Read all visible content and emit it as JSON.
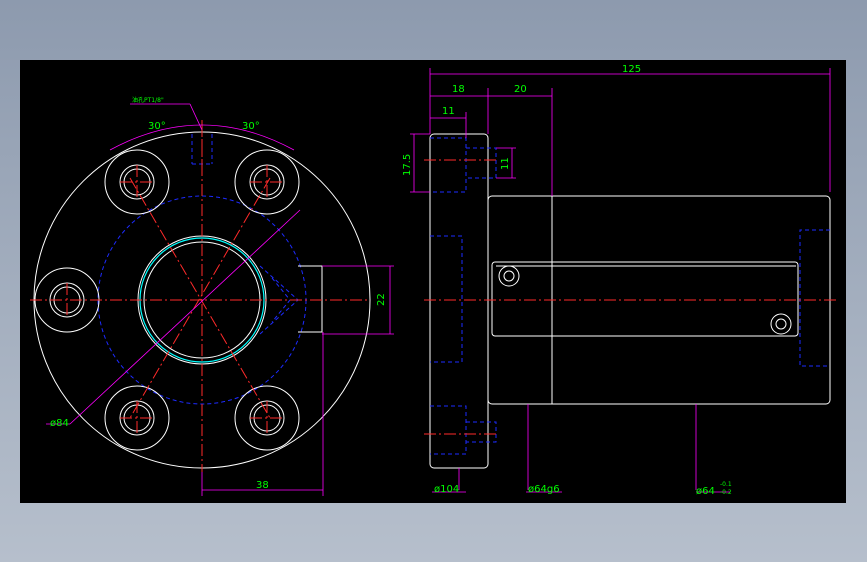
{
  "drawing": {
    "background": "#000000",
    "colors": {
      "outline": "#ffffff",
      "hidden": "#1d2bff",
      "centerline": "#ff2a2a",
      "dimension_line": "#ff00ff",
      "dimension_text": "#00ff00",
      "highlight": "#00ffff"
    }
  },
  "front_view": {
    "oil_hole_note": "油孔PT1/8\"",
    "angle_left": "30°",
    "angle_right": "30°",
    "flange_diameter": "ø84",
    "hole_offset": "38",
    "key_width": "22"
  },
  "side_view": {
    "overall_length": "125",
    "flange_thickness": "18",
    "step_length": "20",
    "counterbore_depth": "11",
    "hole_height": "17.5",
    "counterbore_diameter": "11",
    "flange_outer": "ø104",
    "body_fit": "ø64g6",
    "body_tol_base": "ø64",
    "body_tol_upper": "-0.1",
    "body_tol_lower": "-0.2"
  }
}
